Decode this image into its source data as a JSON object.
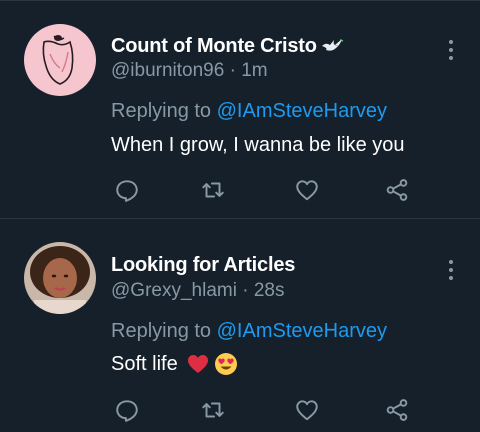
{
  "tweets": [
    {
      "display_name": "Count of Monte Cristo",
      "handle": "@iburniton96",
      "time": "1m",
      "replying_prefix": "Replying to ",
      "replying_to": "@IAmSteveHarvey",
      "text": "When I grow, I wanna be like you",
      "name_icon": "dove-icon"
    },
    {
      "display_name": "Looking for Articles",
      "handle": "@Grexy_hlami",
      "time": "28s",
      "replying_prefix": "Replying to ",
      "replying_to": "@IAmSteveHarvey",
      "text": "Soft life",
      "emojis": [
        "red-heart-emoji",
        "heart-eyes-emoji"
      ]
    }
  ],
  "meta_separator": " · ",
  "colors": {
    "background": "#15202b",
    "secondary_text": "#8899a6",
    "accent": "#1d9bf0",
    "divider": "#2a3640"
  },
  "icons": {
    "actions": [
      "reply-icon",
      "retweet-icon",
      "like-icon",
      "share-icon"
    ],
    "menu": "more-vertical-icon"
  }
}
